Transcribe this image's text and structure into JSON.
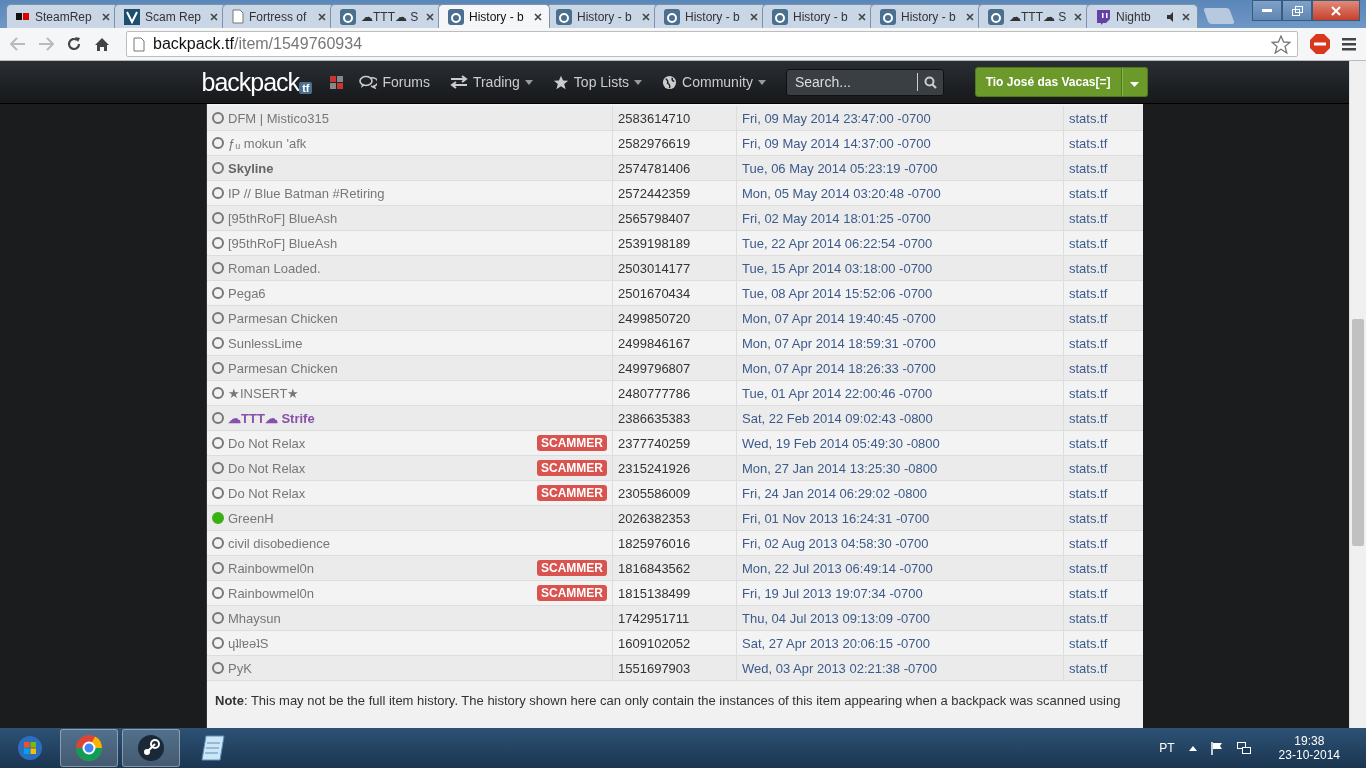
{
  "browser": {
    "tabs": [
      {
        "kind": "sr",
        "title": "SteamRep",
        "selected": false
      },
      {
        "kind": "scam",
        "title": "Scam Rep",
        "selected": false
      },
      {
        "kind": "page",
        "title": "Fortress of",
        "selected": false
      },
      {
        "kind": "tf",
        "title": "☁TTT☁ S",
        "selected": false
      },
      {
        "kind": "tf",
        "title": "History - b",
        "selected": true
      },
      {
        "kind": "tf",
        "title": "History - b",
        "selected": false
      },
      {
        "kind": "tf",
        "title": "History - b",
        "selected": false
      },
      {
        "kind": "tf",
        "title": "History - b",
        "selected": false
      },
      {
        "kind": "tf",
        "title": "History - b",
        "selected": false
      },
      {
        "kind": "tf",
        "title": "☁TTT☁ S",
        "selected": false
      },
      {
        "kind": "twitch",
        "title": "Nightb",
        "selected": false
      }
    ],
    "address": {
      "host": "backpack.tf",
      "path": "/item/1549760934"
    }
  },
  "nav": {
    "logo": "backpack",
    "logo_badge": "tf",
    "links": [
      {
        "kind": "comments",
        "label": "Forums",
        "dropdown": false
      },
      {
        "kind": "arrows",
        "label": "Trading",
        "dropdown": true
      },
      {
        "kind": "star",
        "label": "Top Lists",
        "dropdown": true
      },
      {
        "kind": "globe",
        "label": "Community",
        "dropdown": true
      }
    ],
    "search": {
      "placeholder": "Search..."
    },
    "user": "Tio José das Vacas[=]"
  },
  "history": {
    "rows": [
      {
        "name": "DFM | Mistico315",
        "kind": "plain",
        "online": false,
        "badge": "",
        "id": "2583614710",
        "date": "Fri, 09 May 2014 23:47:00 -0700",
        "link": "stats.tf"
      },
      {
        "name": "ƒᵤ mokun 'afk",
        "kind": "plain",
        "online": false,
        "badge": "",
        "id": "2582976619",
        "date": "Fri, 09 May 2014 14:37:00 -0700",
        "link": "stats.tf"
      },
      {
        "name": "Skyline",
        "kind": "bold",
        "online": false,
        "badge": "",
        "id": "2574781406",
        "date": "Tue, 06 May 2014 05:23:19 -0700",
        "link": "stats.tf"
      },
      {
        "name": "IP // Blue Batman #Retiring",
        "kind": "plain",
        "online": false,
        "badge": "",
        "id": "2572442359",
        "date": "Mon, 05 May 2014 03:20:48 -0700",
        "link": "stats.tf"
      },
      {
        "name": "[95thRoF] BlueAsh",
        "kind": "plain",
        "online": false,
        "badge": "",
        "id": "2565798407",
        "date": "Fri, 02 May 2014 18:01:25 -0700",
        "link": "stats.tf"
      },
      {
        "name": "[95thRoF] BlueAsh",
        "kind": "plain",
        "online": false,
        "badge": "",
        "id": "2539198189",
        "date": "Tue, 22 Apr 2014 06:22:54 -0700",
        "link": "stats.tf"
      },
      {
        "name": "Roman Loaded.",
        "kind": "plain",
        "online": false,
        "badge": "",
        "id": "2503014177",
        "date": "Tue, 15 Apr 2014 03:18:00 -0700",
        "link": "stats.tf"
      },
      {
        "name": "Pega6",
        "kind": "plain",
        "online": false,
        "badge": "",
        "id": "2501670434",
        "date": "Tue, 08 Apr 2014 15:52:06 -0700",
        "link": "stats.tf"
      },
      {
        "name": "Parmesan Chicken",
        "kind": "plain",
        "online": false,
        "badge": "",
        "id": "2499850720",
        "date": "Mon, 07 Apr 2014 19:40:45 -0700",
        "link": "stats.tf"
      },
      {
        "name": "SunlessLime",
        "kind": "plain",
        "online": false,
        "badge": "",
        "id": "2499846167",
        "date": "Mon, 07 Apr 2014 18:59:31 -0700",
        "link": "stats.tf"
      },
      {
        "name": "Parmesan Chicken",
        "kind": "plain",
        "online": false,
        "badge": "",
        "id": "2499796807",
        "date": "Mon, 07 Apr 2014 18:26:33 -0700",
        "link": "stats.tf"
      },
      {
        "name": "★INSERT★",
        "kind": "plain",
        "online": false,
        "badge": "",
        "id": "2480777786",
        "date": "Tue, 01 Apr 2014 22:00:46 -0700",
        "link": "stats.tf"
      },
      {
        "name": "☁TTT☁ Strife",
        "kind": "premium",
        "online": false,
        "badge": "",
        "id": "2386635383",
        "date": "Sat, 22 Feb 2014 09:02:43 -0800",
        "link": "stats.tf"
      },
      {
        "name": "Do Not Relax",
        "kind": "plain",
        "online": false,
        "badge": "SCAMMER",
        "id": "2377740259",
        "date": "Wed, 19 Feb 2014 05:49:30 -0800",
        "link": "stats.tf"
      },
      {
        "name": "Do Not Relax",
        "kind": "plain",
        "online": false,
        "badge": "SCAMMER",
        "id": "2315241926",
        "date": "Mon, 27 Jan 2014 13:25:30 -0800",
        "link": "stats.tf"
      },
      {
        "name": "Do Not Relax",
        "kind": "plain",
        "online": false,
        "badge": "SCAMMER",
        "id": "2305586009",
        "date": "Fri, 24 Jan 2014 06:29:02 -0800",
        "link": "stats.tf"
      },
      {
        "name": "GreenH",
        "kind": "plain",
        "online": true,
        "badge": "",
        "id": "2026382353",
        "date": "Fri, 01 Nov 2013 16:24:31 -0700",
        "link": "stats.tf"
      },
      {
        "name": "civil disobedience",
        "kind": "plain",
        "online": false,
        "badge": "",
        "id": "1825976016",
        "date": "Fri, 02 Aug 2013 04:58:30 -0700",
        "link": "stats.tf"
      },
      {
        "name": "Rainbowmel0n",
        "kind": "plain",
        "online": false,
        "badge": "SCAMMER",
        "id": "1816843562",
        "date": "Mon, 22 Jul 2013 06:49:14 -0700",
        "link": "stats.tf"
      },
      {
        "name": "Rainbowmel0n",
        "kind": "plain",
        "online": false,
        "badge": "SCAMMER",
        "id": "1815138499",
        "date": "Fri, 19 Jul 2013 19:07:34 -0700",
        "link": "stats.tf"
      },
      {
        "name": "Mhaysun",
        "kind": "plain",
        "online": false,
        "badge": "",
        "id": "1742951711",
        "date": "Thu, 04 Jul 2013 09:13:09 -0700",
        "link": "stats.tf"
      },
      {
        "name": "ɥʇlɐǝʇS",
        "kind": "plain",
        "online": false,
        "badge": "",
        "id": "1609102052",
        "date": "Sat, 27 Apr 2013 20:06:15 -0700",
        "link": "stats.tf"
      },
      {
        "name": "PyK",
        "kind": "plain",
        "online": false,
        "badge": "",
        "id": "1551697903",
        "date": "Wed, 03 Apr 2013 02:21:38 -0700",
        "link": "stats.tf"
      }
    ],
    "note": "**Note**: This may not be the full item history. The history shown here can only contain the instances of this item appearing when a backpack was scanned using"
  },
  "taskbar": {
    "apps": [
      {
        "kind": "chrome",
        "selected": true
      },
      {
        "kind": "steam",
        "selected": true
      },
      {
        "kind": "notepad",
        "selected": false
      }
    ],
    "language": "PT",
    "time": "19:38",
    "date": "23-10-2014"
  }
}
